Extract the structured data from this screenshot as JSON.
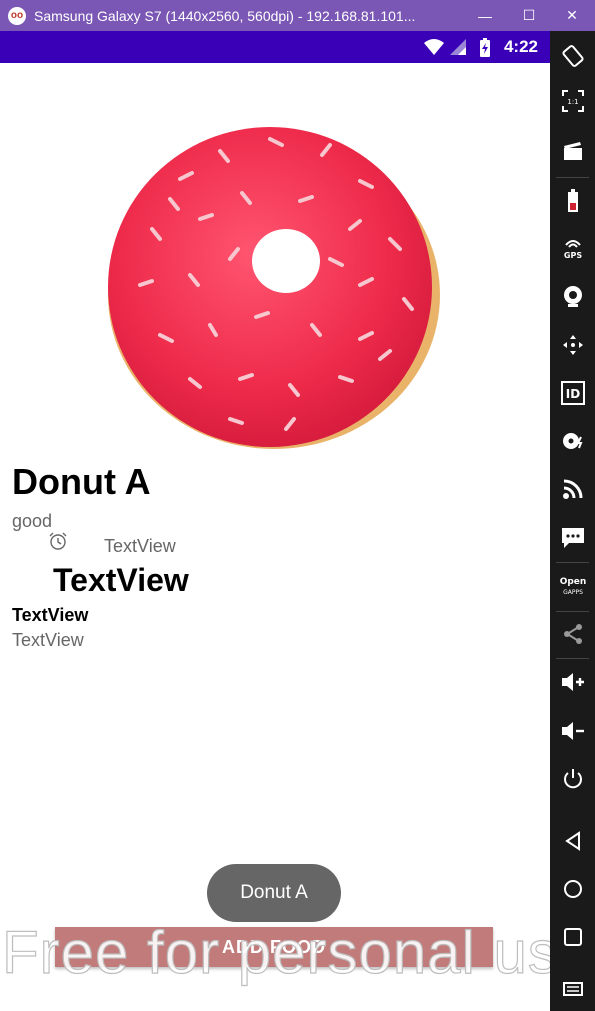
{
  "window": {
    "title": "Samsung Galaxy S7 (1440x2560, 560dpi) - 192.168.81.101...",
    "minimize": "—",
    "maximize": "☐",
    "close": "✕"
  },
  "status_bar": {
    "time": "4:22"
  },
  "food": {
    "name": "Donut A",
    "description": "good",
    "textview_small": "TextView",
    "textview_large": "TextView",
    "textview_bold": "TextView",
    "textview_gray": "TextView"
  },
  "toast": {
    "text": "Donut A"
  },
  "add_button": {
    "label": "ADD FOOD"
  },
  "watermark": "Free for personal use",
  "toolbar": {
    "aspect_label": "1:1",
    "gps_label": "GPS",
    "id_label": "ID",
    "opengapps_label": "Open GAPPS"
  },
  "colors": {
    "title_bar": "#7a57b5",
    "status_bar": "#3a00b8",
    "button": "#c27b7b",
    "toast": "#666666",
    "donut": "#ee2a4a"
  }
}
